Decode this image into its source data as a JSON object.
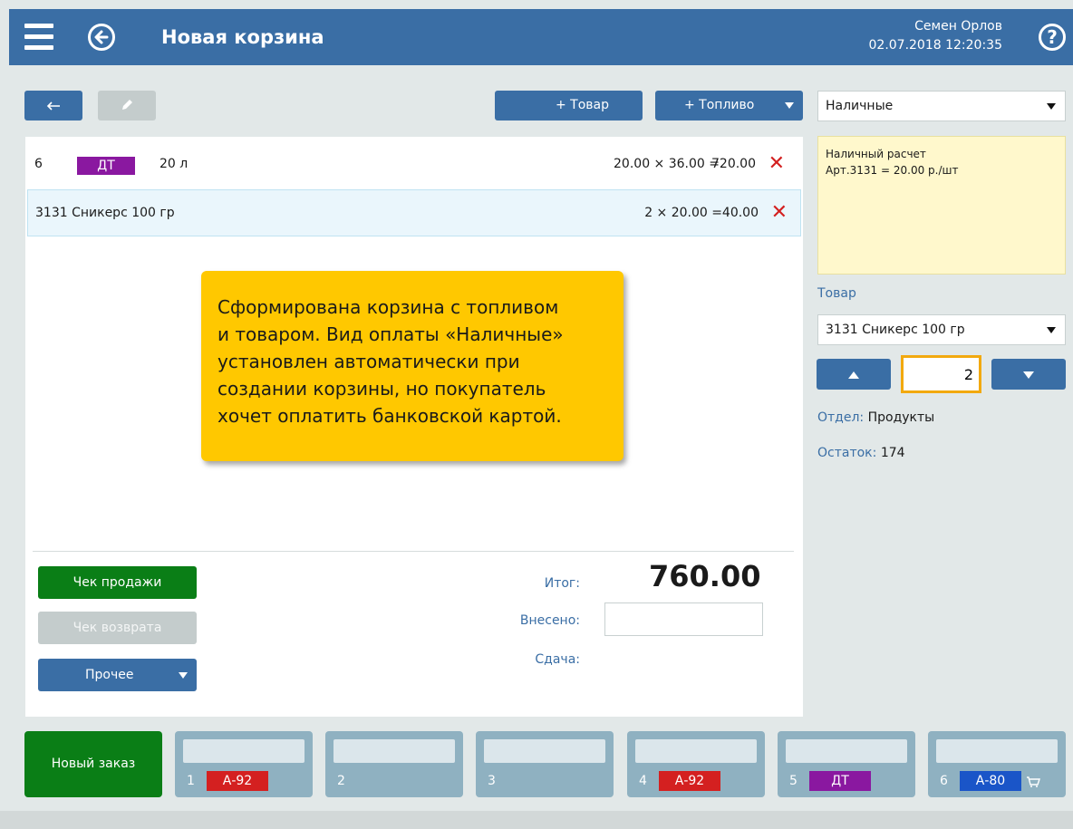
{
  "header": {
    "title": "Новая корзина",
    "user": "Семен Орлов",
    "datetime": "02.07.2018 12:20:35",
    "help": "?"
  },
  "toolbar": {
    "add_product": "+ Товар",
    "add_fuel": "+ Топливо"
  },
  "payment_select": {
    "value": "Наличные"
  },
  "basket": {
    "rows": [
      {
        "code": "6",
        "fuel": "ДТ",
        "qty": "20 л",
        "calc": "20.00 × 36.00 =",
        "sum": "720.00"
      },
      {
        "name": "3131 Сникерс 100 гр",
        "calc": "2 × 20.00 =",
        "sum": "40.00"
      }
    ]
  },
  "callout": {
    "lines": [
      "Сформирована корзина с топливом",
      "и товаром. Вид оплаты «Наличные»",
      "установлен автоматически при",
      "создании корзины, но покупатель",
      "хочет оплатить банковской картой."
    ]
  },
  "actions": {
    "sale_receipt": "Чек продажи",
    "return_receipt": "Чек возврата",
    "other": "Прочее"
  },
  "totals": {
    "total_label": "Итог:",
    "total_value": "760.00",
    "paid_label": "Внесено:",
    "paid_value": "",
    "change_label": "Сдача:"
  },
  "note": {
    "line1": "Наличный расчет",
    "line2": "Арт.3131 = 20.00 р./шт"
  },
  "product_panel": {
    "label": "Товар",
    "selected": "3131  Сникерс 100 гр",
    "quantity": "2",
    "dept_label": "Отдел:",
    "dept_value": "Продукты",
    "stock_label": "Остаток:",
    "stock_value": "174"
  },
  "orders": {
    "new_order": "Новый заказ",
    "slots": [
      {
        "num": "1",
        "fuel": "А-92",
        "color": "#d42020"
      },
      {
        "num": "2",
        "fuel": "",
        "color": ""
      },
      {
        "num": "3",
        "fuel": "",
        "color": ""
      },
      {
        "num": "4",
        "fuel": "А-92",
        "color": "#d42020"
      },
      {
        "num": "5",
        "fuel": "ДТ",
        "color": "#8a18a0"
      },
      {
        "num": "6",
        "fuel": "А-80",
        "color": "#1a55c8"
      }
    ]
  },
  "colors": {
    "header": "#3a6ea5",
    "accent_green": "#0a7e16",
    "callout": "#ffc800",
    "delete": "#d32020"
  }
}
